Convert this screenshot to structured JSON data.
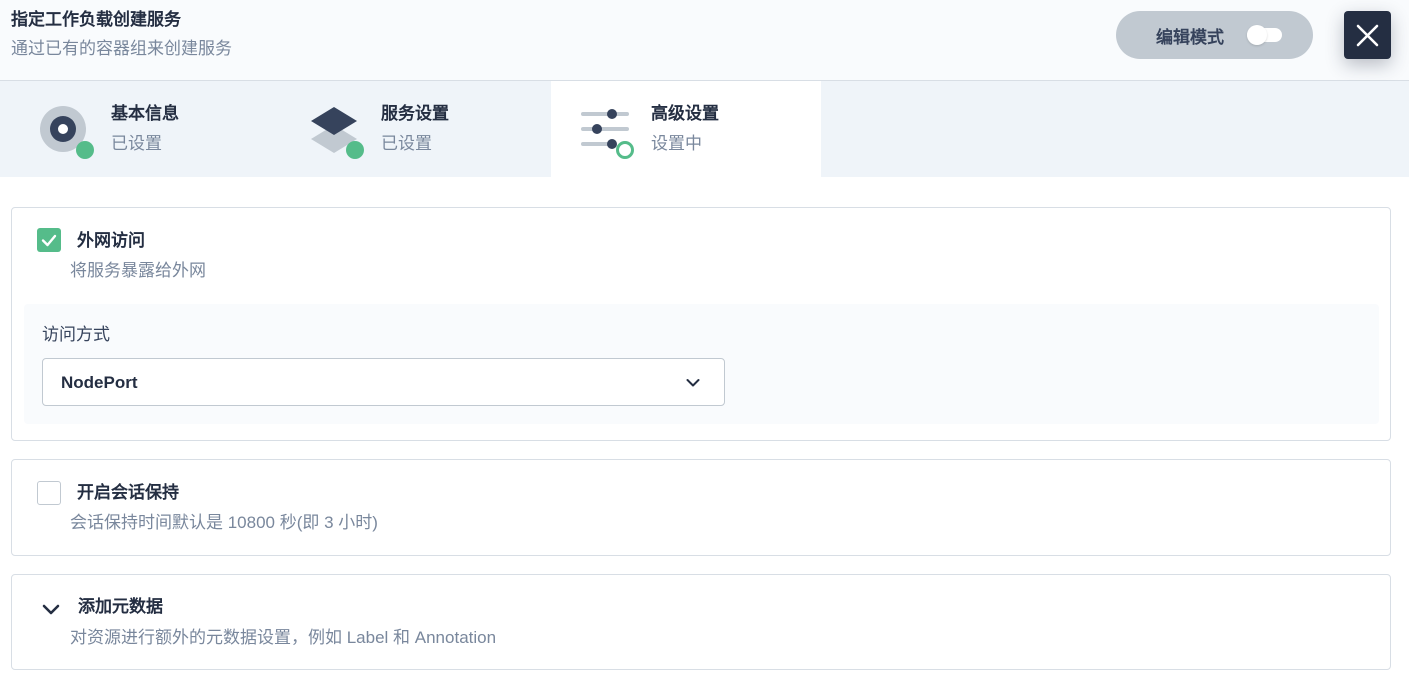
{
  "header": {
    "title": "指定工作负载创建服务",
    "description": "通过已有的容器组来创建服务",
    "edit_mode_label": "编辑模式",
    "close_icon": "close-icon"
  },
  "steps": [
    {
      "title": "基本信息",
      "status": "已设置",
      "icon": "basic-info-icon"
    },
    {
      "title": "服务设置",
      "status": "已设置",
      "icon": "service-settings-icon"
    },
    {
      "title": "高级设置",
      "status": "设置中",
      "icon": "advanced-settings-icon"
    }
  ],
  "external_access": {
    "title": "外网访问",
    "description": "将服务暴露给外网",
    "checked": true,
    "access_mode_label": "访问方式",
    "access_mode_value": "NodePort"
  },
  "session_affinity": {
    "title": "开启会话保持",
    "description": "会话保持时间默认是 10800 秒(即 3 小时)",
    "checked": false
  },
  "metadata": {
    "title": "添加元数据",
    "description": "对资源进行额外的元数据设置，例如 Label 和 Annotation"
  },
  "colors": {
    "accent_green": "#55bc8a",
    "dark": "#242e42",
    "muted": "#79879c"
  }
}
